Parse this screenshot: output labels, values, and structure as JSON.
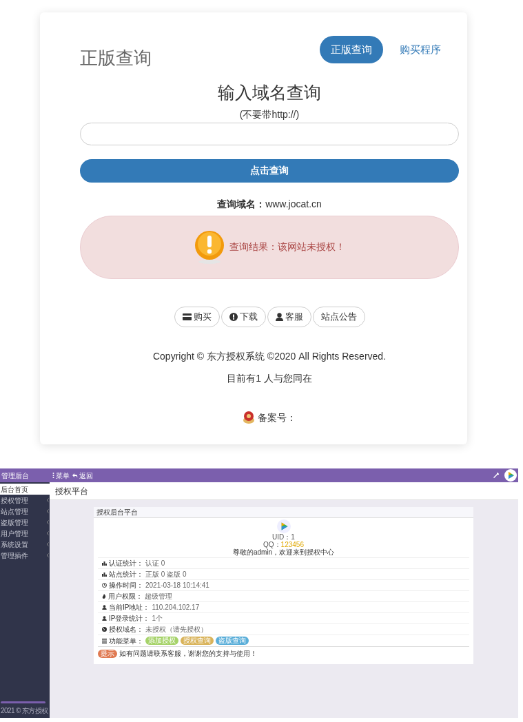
{
  "query_card": {
    "title": "正版查询",
    "nav": [
      {
        "label": "正版查询",
        "selected": true
      },
      {
        "label": "购买程序",
        "selected": false
      }
    ],
    "heading": "输入域名查询",
    "hint": "(不要带http://)",
    "submit": "点击查询",
    "domain_label": "查询域名：",
    "domain": "www.jocat.cn",
    "alert": {
      "kind": "warning",
      "text": "查询结果：该网站未授权！"
    },
    "links": [
      {
        "kind": "card",
        "label": "购买"
      },
      {
        "kind": "info",
        "label": "下载"
      },
      {
        "kind": "user",
        "label": "客服"
      },
      {
        "kind": "none",
        "label": "站点公告"
      }
    ],
    "copyright": "Copyright © 东方授权系统  ©2020 All Rights Reserved.",
    "online": "目前有1 人与您同在",
    "beian": "备案号："
  },
  "admin": {
    "brand": "管理后台",
    "toolbar": [
      {
        "kind": "menu",
        "label": "菜单"
      },
      {
        "kind": "back",
        "label": "返回"
      }
    ],
    "sidebar": [
      {
        "label": "后台首页",
        "selected": true,
        "has_submenu": false
      },
      {
        "label": "授权管理",
        "selected": false,
        "has_submenu": true
      },
      {
        "label": "站点管理",
        "selected": false,
        "has_submenu": true
      },
      {
        "label": "盗版管理",
        "selected": false,
        "has_submenu": true
      },
      {
        "label": "用户管理",
        "selected": false,
        "has_submenu": true
      },
      {
        "label": "系统设置",
        "selected": false,
        "has_submenu": true
      },
      {
        "label": "管理插件",
        "selected": false,
        "has_submenu": true
      }
    ],
    "sidebar_footer": "2021 © 东方授权",
    "page_title": "授权平台",
    "panel_title": "授权后台平台",
    "uid": "UID：1",
    "qq_label": "QQ：",
    "qq": "123456",
    "welcome": "尊敬的admin，欢迎来到授权中心",
    "rows": [
      {
        "kind": "chart",
        "label": "认证统计：",
        "value": "认证 0"
      },
      {
        "kind": "chart",
        "label": "站点统计：",
        "value": "正版 0  盗版 0"
      },
      {
        "kind": "clock",
        "label": "操作时间：",
        "value": "2021-03-18 10:14:41"
      },
      {
        "kind": "fire",
        "label": "用户权限：",
        "value": "超级管理"
      },
      {
        "kind": "user",
        "label": "当前IP地址：",
        "value": "110.204.102.17"
      },
      {
        "kind": "user",
        "label": "IP登录统计：",
        "value": "1个"
      },
      {
        "kind": "globe",
        "label": "授权域名：",
        "value": "未授权（请先授权）"
      }
    ],
    "menu_label": "功能菜单：",
    "tags": [
      {
        "label": "添加授权",
        "color": "#a6d36a"
      },
      {
        "label": "授权查询",
        "color": "#d9b35a"
      },
      {
        "label": "盗版查询",
        "color": "#5aaed9"
      }
    ],
    "note_badge": "提示",
    "note": "如有问题请联系客服，谢谢您的支持与使用！"
  }
}
